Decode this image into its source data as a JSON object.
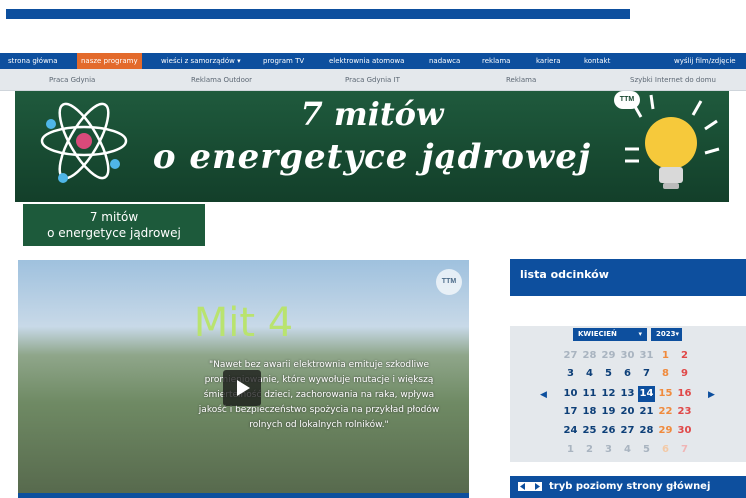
{
  "main_nav": [
    {
      "label": "strona główna"
    },
    {
      "label": "nasze programy",
      "active": true
    },
    {
      "label": "wieści z samorządów ▾"
    },
    {
      "label": "program TV"
    },
    {
      "label": "elektrownia atomowa"
    },
    {
      "label": "nadawca"
    },
    {
      "label": "reklama"
    },
    {
      "label": "kariera"
    },
    {
      "label": "kontakt"
    },
    {
      "label": "wyślij film/zdjęcie"
    }
  ],
  "sub_nav": [
    {
      "label": "Praca Gdynia"
    },
    {
      "label": "Reklama Outdoor"
    },
    {
      "label": "Praca Gdynia IT"
    },
    {
      "label": "Reklama"
    },
    {
      "label": "Szybki Internet do domu"
    }
  ],
  "banner": {
    "line1": "7 mitów",
    "line2": "o energetyce jądrowej",
    "logo": "TTM"
  },
  "small_banner": {
    "line1": "7 mitów",
    "line2": "o energetyce jądrowej"
  },
  "video": {
    "title": "Mit 4",
    "quote": "\"Nawet bez awarii elektrownia emituje szkodliwe promieniowanie, które wywołuje mutacje i większą śmiertelność dzieci, zachorowania na raka, wpływa jakość i bezpieczeństwo spożycia na przykład płodów rolnych od lokalnych rolników.\"",
    "logo": "TTM"
  },
  "sidebar": {
    "episodes_title": "lista odcinków",
    "month_select": "KWIECIEŃ",
    "year_select": "2023",
    "prev_arrow": "◀",
    "next_arrow": "▶",
    "weeks": [
      [
        "27",
        "28",
        "29",
        "30",
        "31",
        "1",
        "2"
      ],
      [
        "3",
        "4",
        "5",
        "6",
        "7",
        "8",
        "9"
      ],
      [
        "10",
        "11",
        "12",
        "13",
        "14",
        "15",
        "16"
      ],
      [
        "17",
        "18",
        "19",
        "20",
        "21",
        "22",
        "23"
      ],
      [
        "24",
        "25",
        "26",
        "27",
        "28",
        "29",
        "30"
      ],
      [
        "1",
        "2",
        "3",
        "4",
        "5",
        "6",
        "7"
      ]
    ],
    "today": "14",
    "footer_label": "tryb poziomy strony głównej"
  },
  "colors": {
    "brand_blue": "#0d4f9e",
    "active_orange": "#e36a2b",
    "banner_green": "#1f5a3d"
  }
}
